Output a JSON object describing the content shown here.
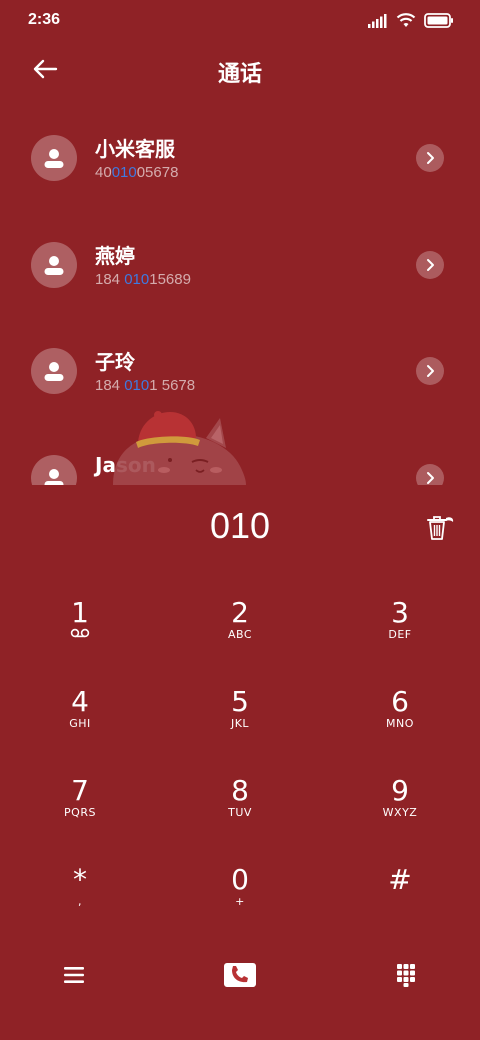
{
  "status_bar": {
    "time": "2:36",
    "icons": [
      "signal-icon",
      "wifi-icon",
      "battery-icon"
    ]
  },
  "header": {
    "title": "通话",
    "back_icon": "arrow-left-icon"
  },
  "contacts": [
    {
      "name": "小米客服",
      "number_pre": "40",
      "number_match": "010",
      "number_post": "05678"
    },
    {
      "name": "燕婷",
      "number_pre": "184 ",
      "number_match": "010",
      "number_post": "15689"
    },
    {
      "name": "子玲",
      "number_pre": "184 ",
      "number_match": "010",
      "number_post": "1 5678"
    },
    {
      "name": "Jason",
      "number_pre": "",
      "number_match": "",
      "number_post": ""
    }
  ],
  "dialer": {
    "input": "010",
    "clear_icon": "trash-icon"
  },
  "keypad": [
    {
      "digit": "1",
      "letters": "voicemail-icon"
    },
    {
      "digit": "2",
      "letters": "ABC"
    },
    {
      "digit": "3",
      "letters": "DEF"
    },
    {
      "digit": "4",
      "letters": "GHI"
    },
    {
      "digit": "5",
      "letters": "JKL"
    },
    {
      "digit": "6",
      "letters": "MNO"
    },
    {
      "digit": "7",
      "letters": "PQRS"
    },
    {
      "digit": "8",
      "letters": "TUV"
    },
    {
      "digit": "9",
      "letters": "WXYZ"
    },
    {
      "digit": "*",
      "letters": ","
    },
    {
      "digit": "0",
      "letters": "+"
    },
    {
      "digit": "#",
      "letters": ""
    }
  ],
  "bottom_bar": {
    "menu_icon": "menu-icon",
    "call_icon": "phone-call-icon",
    "keypad_icon": "dialpad-icon"
  },
  "colors": {
    "background": "#8f2226",
    "highlight": "#3f7ae0",
    "text": "#ffffff"
  }
}
